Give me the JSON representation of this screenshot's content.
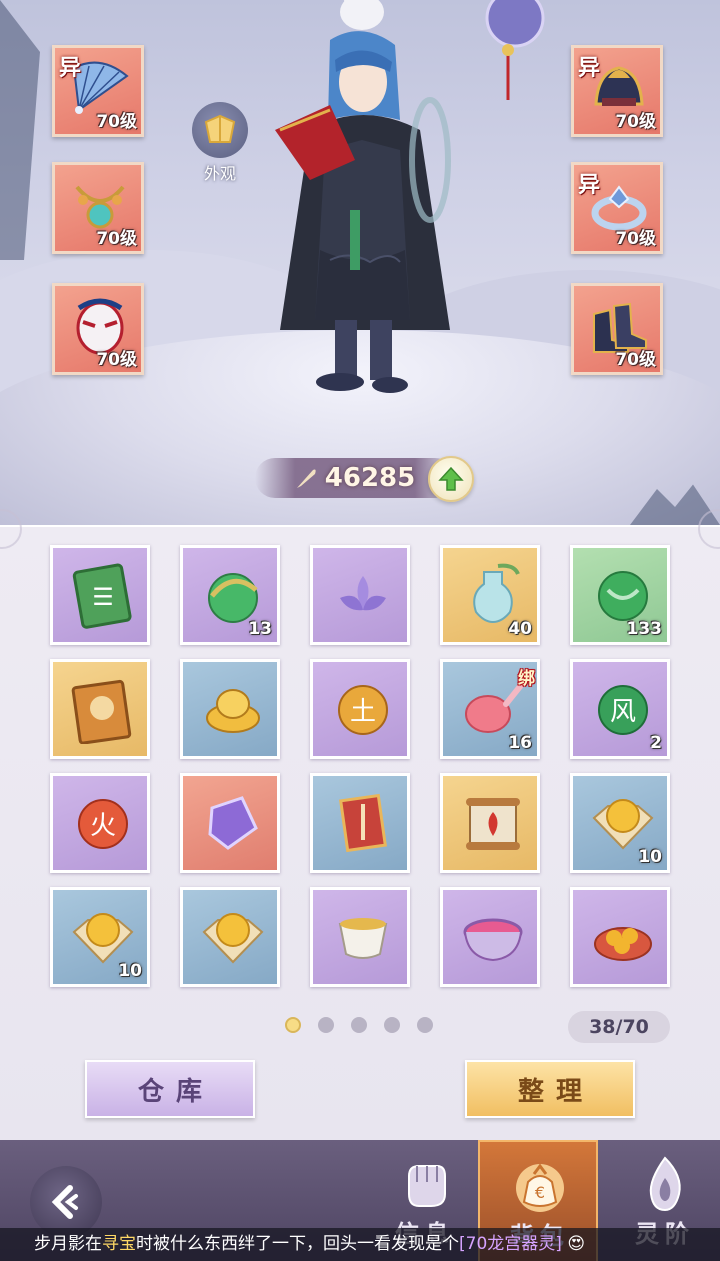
{
  "power": {
    "value": "46285"
  },
  "appearance": {
    "label": "外观"
  },
  "equipment": {
    "left": [
      {
        "name": "fan-weapon",
        "level": "70级",
        "tag": "异"
      },
      {
        "name": "necklace",
        "level": "70级",
        "tag": ""
      },
      {
        "name": "mask",
        "level": "70级",
        "tag": ""
      }
    ],
    "right": [
      {
        "name": "helmet",
        "level": "70级",
        "tag": "异"
      },
      {
        "name": "ring",
        "level": "70级",
        "tag": "异"
      },
      {
        "name": "boots",
        "level": "70级",
        "tag": ""
      }
    ]
  },
  "inventory": {
    "items": [
      {
        "name": "gift-book",
        "rarity": "purple",
        "count": "",
        "bind": ""
      },
      {
        "name": "green-orb",
        "rarity": "purple",
        "count": "13",
        "bind": ""
      },
      {
        "name": "purple-lotus",
        "rarity": "purple",
        "count": "",
        "bind": ""
      },
      {
        "name": "potion-bottle",
        "rarity": "gold",
        "count": "40",
        "bind": ""
      },
      {
        "name": "jade-orb",
        "rarity": "green",
        "count": "133",
        "bind": ""
      },
      {
        "name": "portrait-book",
        "rarity": "gold",
        "count": "",
        "bind": ""
      },
      {
        "name": "gold-ingot",
        "rarity": "blue",
        "count": "",
        "bind": ""
      },
      {
        "name": "earth-orb",
        "rarity": "purple",
        "count": "",
        "bind": ""
      },
      {
        "name": "red-spoon",
        "rarity": "blue",
        "count": "16",
        "bind": "绑"
      },
      {
        "name": "wind-orb",
        "rarity": "purple",
        "count": "2",
        "bind": ""
      },
      {
        "name": "fire-orb",
        "rarity": "purple",
        "count": "",
        "bind": ""
      },
      {
        "name": "purple-crystal",
        "rarity": "red",
        "count": "",
        "bind": ""
      },
      {
        "name": "sword-card",
        "rarity": "blue",
        "count": "",
        "bind": ""
      },
      {
        "name": "flame-scroll",
        "rarity": "gold",
        "count": "",
        "bind": ""
      },
      {
        "name": "pearl-cloth",
        "rarity": "blue",
        "count": "10",
        "bind": ""
      },
      {
        "name": "pearl-cloth",
        "rarity": "blue",
        "count": "10",
        "bind": ""
      },
      {
        "name": "pearl-cloth",
        "rarity": "blue",
        "count": "",
        "bind": ""
      },
      {
        "name": "tea-cup",
        "rarity": "purple",
        "count": "",
        "bind": ""
      },
      {
        "name": "incense-bowl",
        "rarity": "purple",
        "count": "",
        "bind": ""
      },
      {
        "name": "food-box",
        "rarity": "purple",
        "count": "",
        "bind": ""
      }
    ],
    "capacity": "38/70",
    "pages": 5,
    "active_page": 1
  },
  "buttons": {
    "warehouse": "仓库",
    "sort": "整理"
  },
  "nav": {
    "info": "信息",
    "bag": "背包",
    "spirit": "灵阶"
  },
  "ticker": {
    "player": "步月影",
    "part1": "在",
    "place": "寻宝",
    "part2": "时被什么东西绊了一下，回头一看发现是个",
    "item": "[70龙宫器灵]"
  },
  "colors": {
    "accent": "#f1bf62",
    "bind_tag": "#b5121b",
    "panel": "#eeebf3"
  }
}
